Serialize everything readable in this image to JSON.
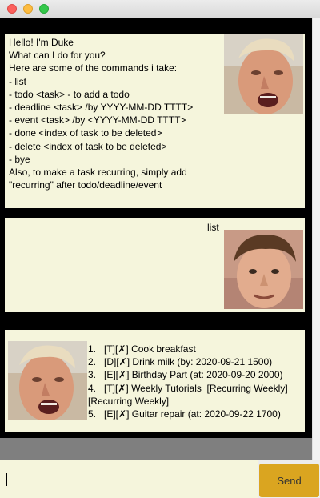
{
  "window": {
    "controls": [
      "close",
      "minimize",
      "zoom"
    ]
  },
  "dialogs": [
    {
      "speaker": "duke",
      "avatar": "gordon-ramsay-photo",
      "text": "Hello! I'm Duke\nWhat can I do for you?\nHere are some of the commands i take:\n- list\n- todo <task> - to add a todo\n- deadline <task> /by YYYY-MM-DD TTTT>\n- event <task> /by <YYYY-MM-DD TTTT>\n- done <index of task to be deleted>\n- delete <index of task to be deleted>\n- bye\nAlso, to make a task recurring, simply add\n\"recurring\" after todo/deadline/event"
    },
    {
      "speaker": "user",
      "avatar": "jamie-oliver-photo",
      "text": "list"
    },
    {
      "speaker": "duke",
      "avatar": "gordon-ramsay-photo",
      "text": "1.   [T][✗] Cook breakfast\n2.   [D][✗] Drink milk (by: 2020-09-21 1500)\n3.   [E][✗] Birthday Part (at: 2020-09-20 2000)\n4.   [T][✗] Weekly Tutorials  [Recurring Weekly]\n[Recurring Weekly]\n5.   [E][✗] Guitar repair (at: 2020-09-22 1700)"
    }
  ],
  "input": {
    "value": "",
    "placeholder": ""
  },
  "send_label": "Send",
  "colors": {
    "bubble_bg": "#f5f5dc",
    "border": "#000000",
    "send_button": "#daa520",
    "gap": "#7f7f7f"
  }
}
